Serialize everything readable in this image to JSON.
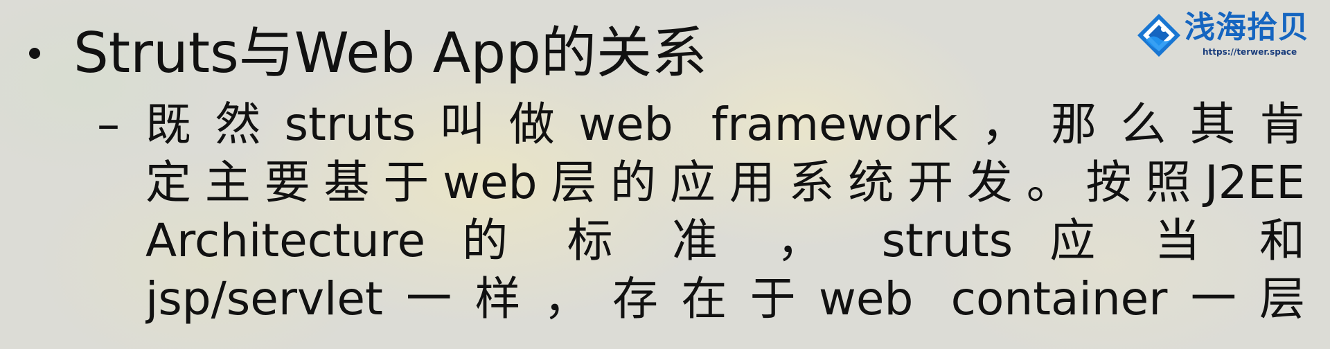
{
  "slide": {
    "bullet_title": "Struts与Web App的关系",
    "sub_dash": "–",
    "sub_lines": [
      "既然struts叫做web framework，那么其肯",
      "定主要基于web层的应用系统开发。按照J2EE",
      "Architecture 的 标 准 ， struts 应 当 和",
      "jsp/servlet一样，存在于web container一层"
    ]
  },
  "logo": {
    "name": "浅海拾贝",
    "url": "https://terwer.space",
    "icon": "diamond-logo-icon"
  },
  "colors": {
    "text": "#111111",
    "logo_blue": "#1565c0",
    "logo_url": "#1a3d7c"
  }
}
